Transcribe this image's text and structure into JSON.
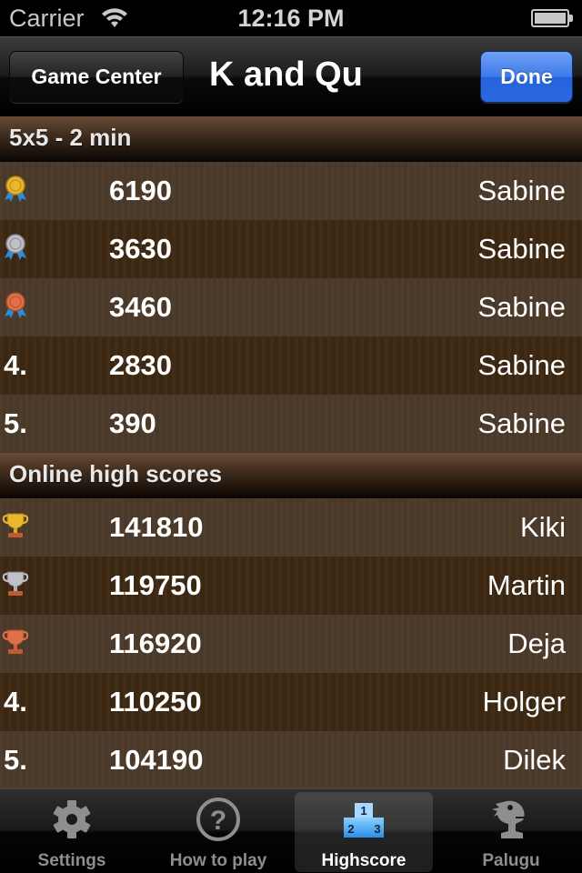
{
  "status_bar": {
    "carrier": "Carrier",
    "time": "12:16 PM",
    "wifi_icon": "wifi-icon",
    "battery_icon": "battery-icon"
  },
  "nav_bar": {
    "left_button": "Game Center",
    "title": "K and Qu",
    "right_button": "Done"
  },
  "local_scores": {
    "header": "5x5 - 2 min",
    "rows": [
      {
        "rank": "1",
        "rank_icon": "gold-medal-icon",
        "score": "6190",
        "name": "Sabine"
      },
      {
        "rank": "2",
        "rank_icon": "silver-medal-icon",
        "score": "3630",
        "name": "Sabine"
      },
      {
        "rank": "3",
        "rank_icon": "bronze-medal-icon",
        "score": "3460",
        "name": "Sabine"
      },
      {
        "rank": "4.",
        "rank_icon": null,
        "score": "2830",
        "name": "Sabine"
      },
      {
        "rank": "5.",
        "rank_icon": null,
        "score": "390",
        "name": "Sabine"
      }
    ]
  },
  "online_scores": {
    "header": "Online high scores",
    "rows": [
      {
        "rank": "1",
        "rank_icon": "gold-trophy-icon",
        "score": "141810",
        "name": "Kiki"
      },
      {
        "rank": "2",
        "rank_icon": "silver-trophy-icon",
        "score": "119750",
        "name": "Martin"
      },
      {
        "rank": "3",
        "rank_icon": "bronze-trophy-icon",
        "score": "116920",
        "name": "Deja"
      },
      {
        "rank": "4.",
        "rank_icon": null,
        "score": "110250",
        "name": "Holger"
      },
      {
        "rank": "5.",
        "rank_icon": null,
        "score": "104190",
        "name": "Dilek"
      }
    ]
  },
  "tab_bar": {
    "tabs": [
      {
        "label": "Settings",
        "icon": "gear-icon",
        "selected": false
      },
      {
        "label": "How to play",
        "icon": "question-circle-icon",
        "selected": false
      },
      {
        "label": "Highscore",
        "icon": "podium-icon",
        "selected": true,
        "podium_labels": [
          "1",
          "2",
          "3"
        ]
      },
      {
        "label": "Palugu",
        "icon": "palugu-bird-icon",
        "selected": false
      }
    ]
  },
  "colors": {
    "done_button": "#2a69e0",
    "row_light": "#4b3a29",
    "row_dark": "#3d2812",
    "gold": "#e8b830",
    "silver": "#c0c0c8",
    "bronze": "#e0704a",
    "ribbon": "#2a8ee0",
    "podium": "#3aa8f0"
  }
}
